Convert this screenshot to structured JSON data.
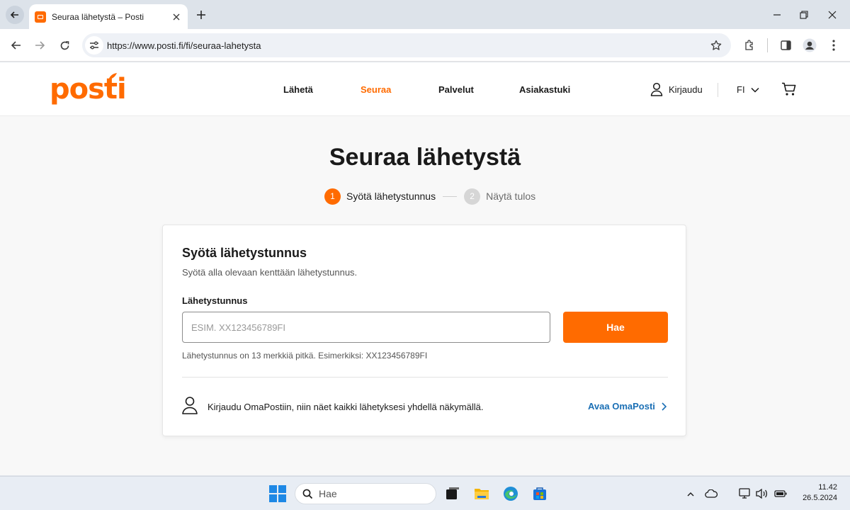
{
  "browser": {
    "tab_title": "Seuraa lähetystä – Posti",
    "url": "https://www.posti.fi/fi/seuraa-lahetysta"
  },
  "site": {
    "logo_text": "posti",
    "nav": [
      "Lähetä",
      "Seuraa",
      "Palvelut",
      "Asiakastuki"
    ],
    "active_nav": "Seuraa",
    "login_label": "Kirjaudu",
    "language": "FI"
  },
  "main": {
    "title": "Seuraa lähetystä",
    "steps": [
      {
        "number": "1",
        "label": "Syötä lähetystunnus",
        "active": true
      },
      {
        "number": "2",
        "label": "Näytä tulos",
        "active": false
      }
    ]
  },
  "card": {
    "title": "Syötä lähetystunnus",
    "subtitle": "Syötä alla olevaan kenttään lähetystunnus.",
    "field_label": "Lähetystunnus",
    "input_value": "",
    "input_placeholder": "ESIM. XX123456789FI",
    "submit_label": "Hae",
    "help_text": "Lähetystunnus on 13 merkkiä pitkä. Esimerkiksi: XX123456789FI",
    "promo_text": "Kirjaudu OmaPostiin, niin näet kaikki lähetyksesi yhdellä näkymällä.",
    "promo_link": "Avaa OmaPosti"
  },
  "taskbar": {
    "search_label": "Hae",
    "time": "11.42",
    "date": "26.5.2024"
  },
  "colors": {
    "brand_orange": "#ff6b00",
    "link_blue": "#1a6fb5"
  },
  "icons": [
    "back-icon",
    "close-icon",
    "plus-icon",
    "minimize-icon",
    "restore-icon",
    "window-close-icon",
    "reload-icon",
    "forward-icon",
    "site-settings-icon",
    "star-icon",
    "extensions-icon",
    "sidepanel-icon",
    "profile-icon",
    "menu-dots-icon",
    "user-icon",
    "chevron-down-icon",
    "cart-icon",
    "chevron-right-icon",
    "search-icon",
    "windows-logo-icon"
  ]
}
